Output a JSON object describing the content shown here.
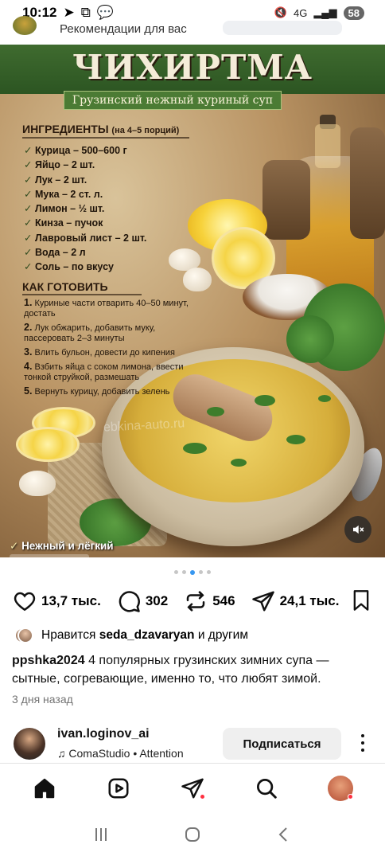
{
  "status_bar": {
    "time": "10:12",
    "network": "4G",
    "battery": "58"
  },
  "header": {
    "recommendations": "Рекомендации для вас"
  },
  "post_image": {
    "title": "ЧИХИРТМА",
    "subtitle": "Грузинский нежный куриный суп",
    "ingredients_heading": "ИНГРЕДИЕНТЫ",
    "ingredients_note": "(на 4–5 порций)",
    "ingredients": [
      "Курица – 500–600 г",
      "Яйцо – 2 шт.",
      "Лук – 2 шт.",
      "Мука – 2 ст. л.",
      "Лимон – ½ шт.",
      "Кинза – пучок",
      "Лавровый лист – 2 шт.",
      "Вода – 2 л",
      "Соль – по вкусу"
    ],
    "steps_heading": "КАК ГОТОВИТЬ",
    "steps": [
      {
        "num": "1.",
        "text": "Куриные части отварить 40–50 минут, достать"
      },
      {
        "num": "2.",
        "text": "Лук обжарить, добавить муку, пассеровать 2–3 минуты"
      },
      {
        "num": "3.",
        "text": "Влить бульон, довести до кипения"
      },
      {
        "num": "4.",
        "text": "Взбить яйца с соком лимона, ввести тонкой струйкой, размешать"
      },
      {
        "num": "5.",
        "text": "Вернуть курицу, добавить зелень"
      }
    ],
    "watermark": "ebkina-auto.ru",
    "bottom_tag": "Нежный и лёгкий"
  },
  "carousel": {
    "total": 5,
    "active": 3
  },
  "actions": {
    "likes": "13,7 тыс.",
    "comments": "302",
    "reposts": "546",
    "shares": "24,1 тыс."
  },
  "liked_by": {
    "prefix": "Нравится",
    "user": "seda_dzavaryan",
    "suffix": "и другим"
  },
  "caption": {
    "username": "ppshka2024",
    "text": "4 популярных грузинских зимних супа — сытные, согревающие, именно то, что любят зимой.",
    "time_ago": "3 дня назад"
  },
  "next_post": {
    "username": "ivan.loginov_ai",
    "music": "ComaStudio • Attention",
    "follow_label": "Подписаться"
  },
  "colors": {
    "accent_blue": "#3897f0",
    "notification_red": "#ff3040",
    "banner_green": "#3f6b2f"
  },
  "icons": {
    "like": "heart-icon",
    "comment": "comment-icon",
    "repost": "repost-icon",
    "share": "send-icon",
    "save": "bookmark-icon",
    "home": "home-icon",
    "reels": "reels-icon",
    "direct": "send-icon",
    "search": "search-icon",
    "mute": "mute-icon"
  }
}
